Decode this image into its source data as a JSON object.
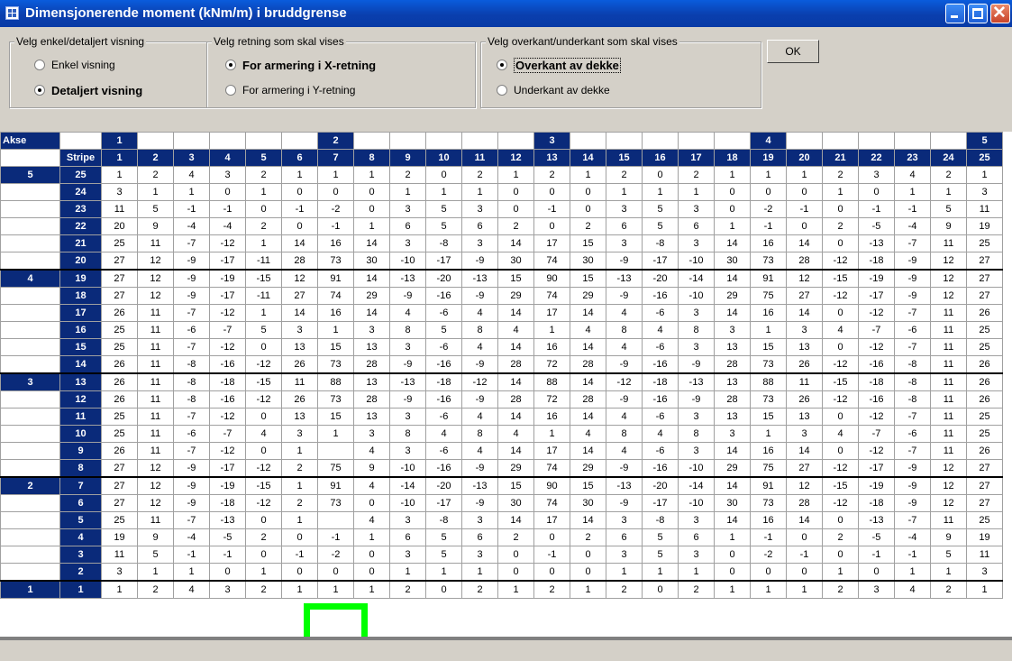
{
  "window": {
    "title": "Dimensjonerende moment (kNm/m) i bruddgrense"
  },
  "view_group": {
    "label": "Velg enkel/detaljert visning",
    "options": [
      {
        "label": "Enkel visning",
        "selected": false
      },
      {
        "label": "Detaljert visning",
        "selected": true
      }
    ]
  },
  "direction_group": {
    "label": "Velg retning som skal vises",
    "options": [
      {
        "label": "For armering i X-retning",
        "selected": true
      },
      {
        "label": "For armering i Y-retning",
        "selected": false
      }
    ]
  },
  "side_group": {
    "label": "Velg overkant/underkant som skal vises",
    "options": [
      {
        "label": "Overkant av dekke",
        "selected": true
      },
      {
        "label": "Underkant av dekke",
        "selected": false
      }
    ]
  },
  "ok_button": "OK",
  "colors": {
    "header": "#0a2a7a",
    "highlight": "#00ff00",
    "titlebar": "#0a4fcc"
  },
  "table": {
    "corner_akse": "Akse",
    "corner_stripe": "Stripe",
    "axis_header": [
      "1",
      "",
      "",
      "",
      "",
      "",
      "2",
      "",
      "",
      "",
      "",
      "",
      "3",
      "",
      "",
      "",
      "",
      "",
      "4",
      "",
      "",
      "",
      "",
      "",
      "5"
    ],
    "stripe_header": [
      "1",
      "2",
      "3",
      "4",
      "5",
      "6",
      "7",
      "8",
      "9",
      "10",
      "11",
      "12",
      "13",
      "14",
      "15",
      "16",
      "17",
      "18",
      "19",
      "20",
      "21",
      "22",
      "23",
      "24",
      "25"
    ],
    "rows": [
      {
        "akse": "5",
        "stripe": "25",
        "values": [
          "1",
          "2",
          "4",
          "3",
          "2",
          "1",
          "1",
          "1",
          "2",
          "0",
          "2",
          "1",
          "2",
          "1",
          "2",
          "0",
          "2",
          "1",
          "1",
          "1",
          "2",
          "3",
          "4",
          "2",
          "1"
        ]
      },
      {
        "akse": "",
        "stripe": "24",
        "values": [
          "3",
          "1",
          "1",
          "0",
          "1",
          "0",
          "0",
          "0",
          "1",
          "1",
          "1",
          "0",
          "0",
          "0",
          "1",
          "1",
          "1",
          "0",
          "0",
          "0",
          "1",
          "0",
          "1",
          "1",
          "3"
        ]
      },
      {
        "akse": "",
        "stripe": "23",
        "values": [
          "11",
          "5",
          "-1",
          "-1",
          "0",
          "-1",
          "-2",
          "0",
          "3",
          "5",
          "3",
          "0",
          "-1",
          "0",
          "3",
          "5",
          "3",
          "0",
          "-2",
          "-1",
          "0",
          "-1",
          "-1",
          "5",
          "11"
        ]
      },
      {
        "akse": "",
        "stripe": "22",
        "values": [
          "20",
          "9",
          "-4",
          "-4",
          "2",
          "0",
          "-1",
          "1",
          "6",
          "5",
          "6",
          "2",
          "0",
          "2",
          "6",
          "5",
          "6",
          "1",
          "-1",
          "0",
          "2",
          "-5",
          "-4",
          "9",
          "19"
        ]
      },
      {
        "akse": "",
        "stripe": "21",
        "values": [
          "25",
          "11",
          "-7",
          "-12",
          "1",
          "14",
          "16",
          "14",
          "3",
          "-8",
          "3",
          "14",
          "17",
          "15",
          "3",
          "-8",
          "3",
          "14",
          "16",
          "14",
          "0",
          "-13",
          "-7",
          "11",
          "25"
        ]
      },
      {
        "akse": "",
        "stripe": "20",
        "values": [
          "27",
          "12",
          "-9",
          "-17",
          "-11",
          "28",
          "73",
          "30",
          "-10",
          "-17",
          "-9",
          "30",
          "74",
          "30",
          "-9",
          "-17",
          "-10",
          "30",
          "73",
          "28",
          "-12",
          "-18",
          "-9",
          "12",
          "27"
        ]
      },
      {
        "akse": "4",
        "stripe": "19",
        "values": [
          "27",
          "12",
          "-9",
          "-19",
          "-15",
          "12",
          "91",
          "14",
          "-13",
          "-20",
          "-13",
          "15",
          "90",
          "15",
          "-13",
          "-20",
          "-14",
          "14",
          "91",
          "12",
          "-15",
          "-19",
          "-9",
          "12",
          "27"
        ]
      },
      {
        "akse": "",
        "stripe": "18",
        "values": [
          "27",
          "12",
          "-9",
          "-17",
          "-11",
          "27",
          "74",
          "29",
          "-9",
          "-16",
          "-9",
          "29",
          "74",
          "29",
          "-9",
          "-16",
          "-10",
          "29",
          "75",
          "27",
          "-12",
          "-17",
          "-9",
          "12",
          "27"
        ]
      },
      {
        "akse": "",
        "stripe": "17",
        "values": [
          "26",
          "11",
          "-7",
          "-12",
          "1",
          "14",
          "16",
          "14",
          "4",
          "-6",
          "4",
          "14",
          "17",
          "14",
          "4",
          "-6",
          "3",
          "14",
          "16",
          "14",
          "0",
          "-12",
          "-7",
          "11",
          "26"
        ]
      },
      {
        "akse": "",
        "stripe": "16",
        "values": [
          "25",
          "11",
          "-6",
          "-7",
          "5",
          "3",
          "1",
          "3",
          "8",
          "5",
          "8",
          "4",
          "1",
          "4",
          "8",
          "4",
          "8",
          "3",
          "1",
          "3",
          "4",
          "-7",
          "-6",
          "11",
          "25"
        ]
      },
      {
        "akse": "",
        "stripe": "15",
        "values": [
          "25",
          "11",
          "-7",
          "-12",
          "0",
          "13",
          "15",
          "13",
          "3",
          "-6",
          "4",
          "14",
          "16",
          "14",
          "4",
          "-6",
          "3",
          "13",
          "15",
          "13",
          "0",
          "-12",
          "-7",
          "11",
          "25"
        ]
      },
      {
        "akse": "",
        "stripe": "14",
        "values": [
          "26",
          "11",
          "-8",
          "-16",
          "-12",
          "26",
          "73",
          "28",
          "-9",
          "-16",
          "-9",
          "28",
          "72",
          "28",
          "-9",
          "-16",
          "-9",
          "28",
          "73",
          "26",
          "-12",
          "-16",
          "-8",
          "11",
          "26"
        ]
      },
      {
        "akse": "3",
        "stripe": "13",
        "values": [
          "26",
          "11",
          "-8",
          "-18",
          "-15",
          "11",
          "88",
          "13",
          "-13",
          "-18",
          "-12",
          "14",
          "88",
          "14",
          "-12",
          "-18",
          "-13",
          "13",
          "88",
          "11",
          "-15",
          "-18",
          "-8",
          "11",
          "26"
        ]
      },
      {
        "akse": "",
        "stripe": "12",
        "values": [
          "26",
          "11",
          "-8",
          "-16",
          "-12",
          "26",
          "73",
          "28",
          "-9",
          "-16",
          "-9",
          "28",
          "72",
          "28",
          "-9",
          "-16",
          "-9",
          "28",
          "73",
          "26",
          "-12",
          "-16",
          "-8",
          "11",
          "26"
        ]
      },
      {
        "akse": "",
        "stripe": "11",
        "values": [
          "25",
          "11",
          "-7",
          "-12",
          "0",
          "13",
          "15",
          "13",
          "3",
          "-6",
          "4",
          "14",
          "16",
          "14",
          "4",
          "-6",
          "3",
          "13",
          "15",
          "13",
          "0",
          "-12",
          "-7",
          "11",
          "25"
        ]
      },
      {
        "akse": "",
        "stripe": "10",
        "values": [
          "25",
          "11",
          "-6",
          "-7",
          "4",
          "3",
          "1",
          "3",
          "8",
          "4",
          "8",
          "4",
          "1",
          "4",
          "8",
          "4",
          "8",
          "3",
          "1",
          "3",
          "4",
          "-7",
          "-6",
          "11",
          "25"
        ]
      },
      {
        "akse": "",
        "stripe": "9",
        "values": [
          "26",
          "11",
          "-7",
          "-12",
          "0",
          "1",
          "",
          "4",
          "3",
          "-6",
          "4",
          "14",
          "17",
          "14",
          "4",
          "-6",
          "3",
          "14",
          "16",
          "14",
          "0",
          "-12",
          "-7",
          "11",
          "26"
        ]
      },
      {
        "akse": "",
        "stripe": "8",
        "values": [
          "27",
          "12",
          "-9",
          "-17",
          "-12",
          "2",
          "75",
          "9",
          "-10",
          "-16",
          "-9",
          "29",
          "74",
          "29",
          "-9",
          "-16",
          "-10",
          "29",
          "75",
          "27",
          "-12",
          "-17",
          "-9",
          "12",
          "27"
        ]
      },
      {
        "akse": "2",
        "stripe": "7",
        "values": [
          "27",
          "12",
          "-9",
          "-19",
          "-15",
          "1",
          "91",
          "4",
          "-14",
          "-20",
          "-13",
          "15",
          "90",
          "15",
          "-13",
          "-20",
          "-14",
          "14",
          "91",
          "12",
          "-15",
          "-19",
          "-9",
          "12",
          "27"
        ]
      },
      {
        "akse": "",
        "stripe": "6",
        "values": [
          "27",
          "12",
          "-9",
          "-18",
          "-12",
          "2",
          "73",
          "0",
          "-10",
          "-17",
          "-9",
          "30",
          "74",
          "30",
          "-9",
          "-17",
          "-10",
          "30",
          "73",
          "28",
          "-12",
          "-18",
          "-9",
          "12",
          "27"
        ]
      },
      {
        "akse": "",
        "stripe": "5",
        "values": [
          "25",
          "11",
          "-7",
          "-13",
          "0",
          "1",
          "",
          "4",
          "3",
          "-8",
          "3",
          "14",
          "17",
          "14",
          "3",
          "-8",
          "3",
          "14",
          "16",
          "14",
          "0",
          "-13",
          "-7",
          "11",
          "25"
        ]
      },
      {
        "akse": "",
        "stripe": "4",
        "values": [
          "19",
          "9",
          "-4",
          "-5",
          "2",
          "0",
          "-1",
          "1",
          "6",
          "5",
          "6",
          "2",
          "0",
          "2",
          "6",
          "5",
          "6",
          "1",
          "-1",
          "0",
          "2",
          "-5",
          "-4",
          "9",
          "19"
        ]
      },
      {
        "akse": "",
        "stripe": "3",
        "values": [
          "11",
          "5",
          "-1",
          "-1",
          "0",
          "-1",
          "-2",
          "0",
          "3",
          "5",
          "3",
          "0",
          "-1",
          "0",
          "3",
          "5",
          "3",
          "0",
          "-2",
          "-1",
          "0",
          "-1",
          "-1",
          "5",
          "11"
        ]
      },
      {
        "akse": "",
        "stripe": "2",
        "values": [
          "3",
          "1",
          "1",
          "0",
          "1",
          "0",
          "0",
          "0",
          "1",
          "1",
          "1",
          "0",
          "0",
          "0",
          "1",
          "1",
          "1",
          "0",
          "0",
          "0",
          "1",
          "0",
          "1",
          "1",
          "3"
        ]
      },
      {
        "akse": "1",
        "stripe": "1",
        "values": [
          "1",
          "2",
          "4",
          "3",
          "2",
          "1",
          "1",
          "1",
          "2",
          "0",
          "2",
          "1",
          "2",
          "1",
          "2",
          "0",
          "2",
          "1",
          "1",
          "1",
          "2",
          "3",
          "4",
          "2",
          "1"
        ]
      }
    ]
  }
}
